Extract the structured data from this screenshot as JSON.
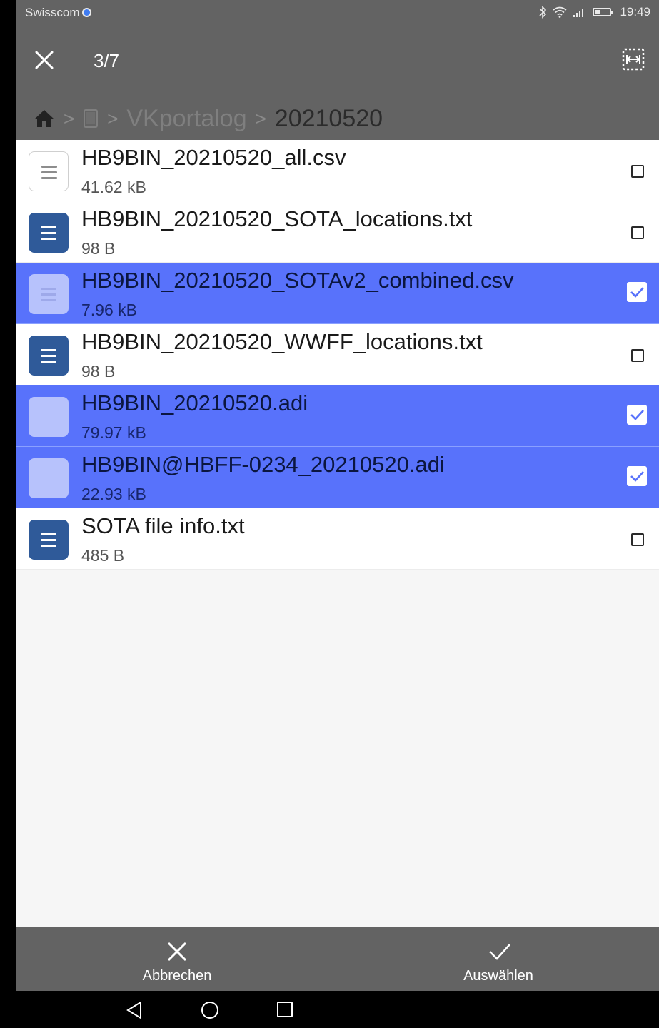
{
  "status_bar": {
    "carrier": "Swisscom",
    "time": "19:49",
    "icons": [
      "bluetooth-icon",
      "wifi-icon",
      "signal-icon",
      "battery-icon"
    ]
  },
  "toolbar": {
    "close_icon": "close-icon",
    "selection_count": "3/7",
    "select_all_icon": "select-all-icon"
  },
  "breadcrumb": {
    "home_icon": "home-icon",
    "device_icon": "tablet-icon",
    "folder": "VKportalog",
    "current": "20210520"
  },
  "files": [
    {
      "name": "HB9BIN_20210520_all.csv",
      "size": "41.62 kB",
      "icon": "csv-file-icon",
      "selected": false
    },
    {
      "name": "HB9BIN_20210520_SOTA_locations.txt",
      "size": "98 B",
      "icon": "text-file-icon",
      "selected": false
    },
    {
      "name": "HB9BIN_20210520_SOTAv2_combined.csv",
      "size": "7.96 kB",
      "icon": "csv-file-icon",
      "selected": true
    },
    {
      "name": "HB9BIN_20210520_WWFF_locations.txt",
      "size": "98 B",
      "icon": "text-file-icon",
      "selected": false
    },
    {
      "name": "HB9BIN_20210520.adi",
      "size": "79.97 kB",
      "icon": "file-icon",
      "selected": true
    },
    {
      "name": "HB9BIN@HBFF-0234_20210520.adi",
      "size": "22.93 kB",
      "icon": "file-icon",
      "selected": true
    },
    {
      "name": "SOTA file info.txt",
      "size": "485 B",
      "icon": "text-file-icon",
      "selected": false
    }
  ],
  "bottom_bar": {
    "cancel_label": "Abbrechen",
    "select_label": "Auswählen"
  },
  "colors": {
    "toolbar": "#636363",
    "selected_row": "#5872fb",
    "doc_icon": "#2f5a99"
  }
}
